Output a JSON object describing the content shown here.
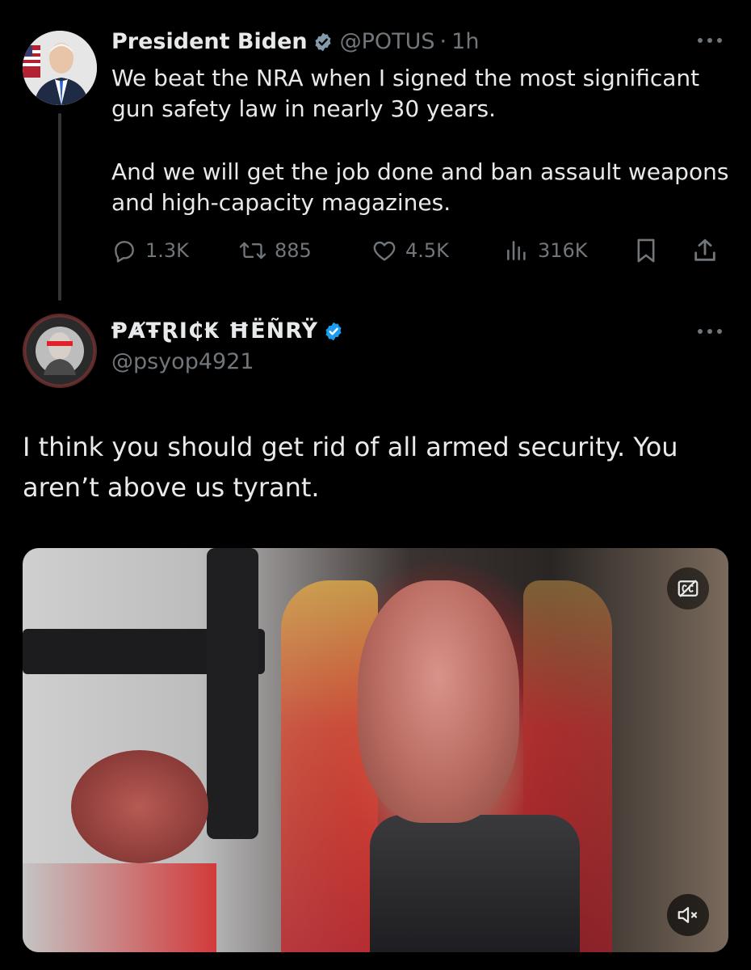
{
  "tweet1": {
    "author_name": "President Biden",
    "handle": "@POTUS",
    "separator": "·",
    "time": "1h",
    "body_lines": [
      "We beat the NRA when I signed the most significant gun safety law in nearly 30 years.",
      "And we will get the job done and ban assault weapons and high-capacity magazines."
    ],
    "replies": "1.3K",
    "retweets": "885",
    "likes": "4.5K",
    "views": "316K",
    "icons": {
      "reply": "reply-icon",
      "retweet": "retweet-icon",
      "like": "heart-icon",
      "views": "views-icon",
      "bookmark": "bookmark-icon",
      "share": "share-icon",
      "verified": "verified-badge-icon",
      "more": "more-icon"
    }
  },
  "tweet2": {
    "author_name": "ⱣȺŦⱤI₵₭ ĦËÑRŸ",
    "handle": "@psyop4921",
    "body": "I think you should get rid of all armed security. You aren’t above us tyrant.",
    "icons": {
      "verified": "verified-badge-icon",
      "more": "more-icon",
      "captions": "captions-icon",
      "mute": "muted-speaker-icon"
    }
  },
  "colors": {
    "background": "#000000",
    "text_primary": "#e7e9ea",
    "text_secondary": "#71767b",
    "verified_gray": "#829aab",
    "verified_blue": "#1d9bf0",
    "thread_line": "#333639"
  }
}
